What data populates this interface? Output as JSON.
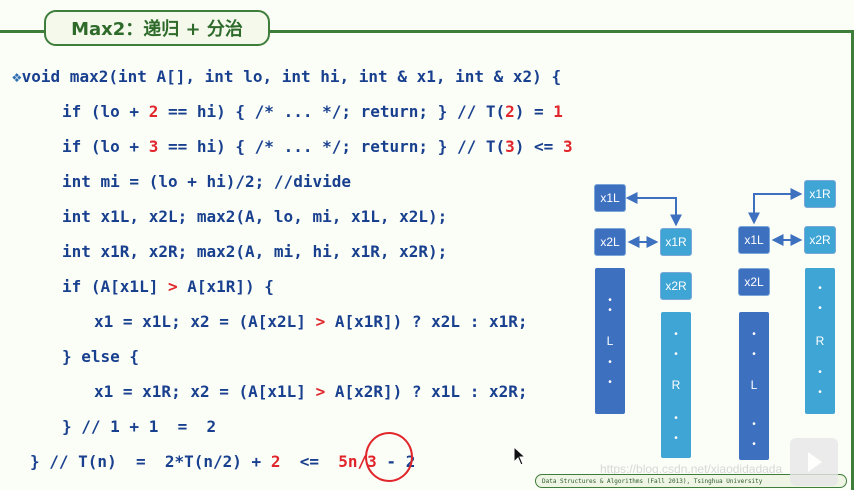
{
  "slide": {
    "title": "Max2：递归 + 分治",
    "bullet": "❖",
    "code": {
      "l0": "void max2(int A[], int lo, int hi, int & x1, int & x2) {",
      "l1": {
        "a": "if (lo + ",
        "b": "2",
        "c": " == hi) { /* ... */; return; } // T(",
        "d": "2",
        "e": ") = ",
        "f": "1"
      },
      "l2": {
        "a": "if (lo + ",
        "b": "3",
        "c": " == hi) { /* ... */; return; } // T(",
        "d": "3",
        "e": ") <= ",
        "f": "3"
      },
      "l3": "int mi = (lo + hi)/2; //divide",
      "l4": "int x1L, x2L; max2(A, lo, mi, x1L, x2L);",
      "l5": "int x1R, x2R; max2(A, mi, hi, x1R, x2R);",
      "l6": {
        "a": "if (A[x1L] ",
        "b": ">",
        "c": " A[x1R]) {"
      },
      "l7": {
        "a": "x1 = x1L; x2 = (A[x2L] ",
        "b": ">",
        "c": " A[x1R]) ? x2L : x1R;"
      },
      "l8": "} else {",
      "l9": {
        "a": "x1 = x1R; x2 = (A[x1L] ",
        "b": ">",
        "c": " A[x2R]) ? x1L : x2R;"
      },
      "l10": "} // 1 + 1  =  2",
      "l11": {
        "a": "} // T(n)  =  2*T(n/2) + ",
        "b": "2",
        "c": "  <=  ",
        "d": "5n/3",
        "e": " - 2"
      }
    }
  },
  "diagram": {
    "left": {
      "nodes": [
        "x1L",
        "x2L",
        "x1R",
        "x2R"
      ],
      "bar_left_label": "L",
      "bar_right_label": "R"
    },
    "right": {
      "nodes": [
        "x1R",
        "x1L",
        "x2R",
        "x2L"
      ],
      "bar_left_label": "L",
      "bar_right_label": "R"
    },
    "colors": {
      "dark": "#3d70bf",
      "light": "#3ea5d4"
    }
  },
  "footer": "Data Structures & Algorithms (Fall 2013), Tsinghua University",
  "watermark": "https://blog.csdn.net/xiaodidadada",
  "colors": {
    "code": "#18408e",
    "highlight": "#e0262b",
    "frame": "#3f7d3b"
  }
}
